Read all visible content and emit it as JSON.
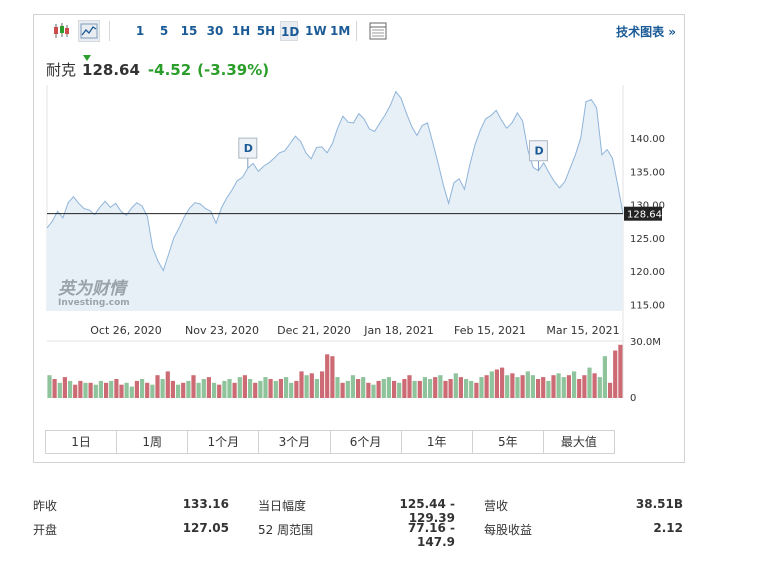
{
  "toolbar": {
    "chart_type_icons": [
      "candlestick-icon",
      "line-chart-icon"
    ],
    "intervals": [
      "1",
      "5",
      "15",
      "30",
      "1H",
      "5H",
      "1D",
      "1W",
      "1M"
    ],
    "active_interval": "1D",
    "table_icon": "table-icon",
    "tech_chart_label": "技术图表 »"
  },
  "quote": {
    "name": "耐克",
    "price": "128.64",
    "change": "-4.52",
    "change_pct": "(-3.39%)",
    "trend_icon": "down-triangle-icon",
    "change_color": "#2a9d2a"
  },
  "watermark": {
    "brand_cn": "英为财情",
    "brand_en": "Investing.com"
  },
  "chart_data": {
    "type": "area",
    "x_tick_labels": [
      "Oct 26, 2020",
      "Nov 23, 2020",
      "Dec 21, 2020",
      "Jan 18, 2021",
      "Feb 15, 2021",
      "Mar 15, 2021"
    ],
    "y_tick_labels": [
      "140.00",
      "135.00",
      "130.00",
      "125.00",
      "120.00",
      "115.00"
    ],
    "ylim": [
      114,
      148
    ],
    "current_price_label": "128.64",
    "current_price": 128.64,
    "dividend_marker_label": "D",
    "dividend_markers_index": [
      38,
      93
    ],
    "price": [
      126.5,
      127.5,
      129,
      128,
      130.3,
      131.2,
      130.2,
      129.4,
      129.2,
      128.5,
      129.6,
      130.5,
      129.6,
      130.2,
      129.0,
      128.4,
      129.5,
      130.3,
      129.8,
      128.2,
      123.5,
      121.5,
      120.1,
      122.5,
      125.0,
      126.5,
      128.2,
      129.5,
      130.3,
      130.1,
      129.4,
      129.0,
      127.2,
      129.5,
      131.0,
      132.2,
      133.6,
      134.1,
      135.5,
      136.2,
      135.0,
      135.8,
      136.3,
      137.0,
      137.8,
      138.1,
      139.2,
      140.3,
      139.5,
      137.8,
      136.9,
      138.6,
      138.7,
      137.8,
      139.2,
      141.5,
      143.3,
      142.4,
      142.3,
      143.7,
      142.9,
      141.4,
      141.0,
      142.3,
      143.5,
      145.0,
      147.0,
      146.0,
      143.8,
      141.8,
      140.4,
      141.9,
      142.3,
      139.3,
      136.3,
      133.0,
      130.2,
      133.3,
      133.9,
      132.3,
      136.0,
      139.0,
      141.2,
      142.9,
      143.4,
      144.2,
      142.7,
      141.5,
      142.3,
      143.8,
      142.6,
      138.2,
      135.6,
      135.1,
      136.3,
      134.8,
      133.5,
      132.5,
      133.5,
      135.5,
      137.5,
      140.0,
      145.5,
      145.8,
      144.6,
      137.5,
      138.3,
      137.0,
      133.0,
      128.64
    ],
    "volume_axis_labels": [
      "30.0M",
      "0"
    ],
    "volume_max": 30,
    "volume": [
      12,
      10,
      8,
      11,
      9,
      7,
      9,
      8,
      8,
      7,
      9,
      8,
      9,
      10,
      7,
      8,
      6,
      9,
      10,
      8,
      7,
      12,
      10,
      14,
      9,
      7,
      8,
      9,
      12,
      8,
      10,
      11,
      8,
      7,
      9,
      10,
      8,
      11,
      12,
      10,
      8,
      9,
      11,
      10,
      9,
      10,
      11,
      8,
      9,
      14,
      12,
      13,
      10,
      14,
      23,
      22,
      11,
      8,
      9,
      12,
      10,
      11,
      8,
      7,
      9,
      10,
      11,
      9,
      8,
      10,
      12,
      9,
      9,
      11,
      10,
      11,
      12,
      9,
      10,
      13,
      11,
      10,
      9,
      8,
      11,
      12,
      14,
      15,
      16,
      12,
      13,
      11,
      12,
      14,
      12,
      10,
      11,
      9,
      12,
      13,
      11,
      12,
      14,
      10,
      12,
      16,
      13,
      11,
      22,
      8,
      25,
      28
    ],
    "volume_down": [
      0,
      1,
      0,
      1,
      0,
      1,
      1,
      0,
      1,
      0,
      0,
      1,
      0,
      1,
      1,
      0,
      0,
      1,
      0,
      1,
      0,
      1,
      0,
      1,
      1,
      0,
      1,
      0,
      1,
      0,
      0,
      1,
      0,
      1,
      0,
      0,
      1,
      0,
      1,
      0,
      1,
      0,
      0,
      1,
      0,
      1,
      0,
      0,
      1,
      1,
      0,
      1,
      0,
      1,
      1,
      1,
      0,
      1,
      0,
      0,
      1,
      0,
      1,
      0,
      1,
      0,
      0,
      1,
      0,
      1,
      1,
      0,
      1,
      0,
      0,
      1,
      0,
      1,
      1,
      0,
      1,
      0,
      0,
      1,
      0,
      1,
      0,
      1,
      1,
      0,
      1,
      0,
      1,
      0,
      0,
      1,
      1,
      0,
      1,
      0,
      0,
      1,
      0,
      1,
      1,
      0,
      1,
      0,
      0,
      1,
      1,
      1
    ],
    "line_color": "#8fb4d9",
    "fill_color": "#e7eff7",
    "up_volume_color": "#8fc39b",
    "down_volume_color": "#cc6b74"
  },
  "range_buttons": [
    "1日",
    "1周",
    "1个月",
    "3个月",
    "6个月",
    "1年",
    "5年",
    "最大值"
  ],
  "stats": [
    [
      {
        "label": "昨收",
        "value": "133.16"
      },
      {
        "label": "当日幅度",
        "value": "125.44 - 129.39"
      },
      {
        "label": "营收",
        "value": "38.51B"
      }
    ],
    [
      {
        "label": "开盘",
        "value": "127.05"
      },
      {
        "label": "52 周范围",
        "value": "77.16 - 147.9"
      },
      {
        "label": "每股收益",
        "value": "2.12"
      }
    ]
  ]
}
